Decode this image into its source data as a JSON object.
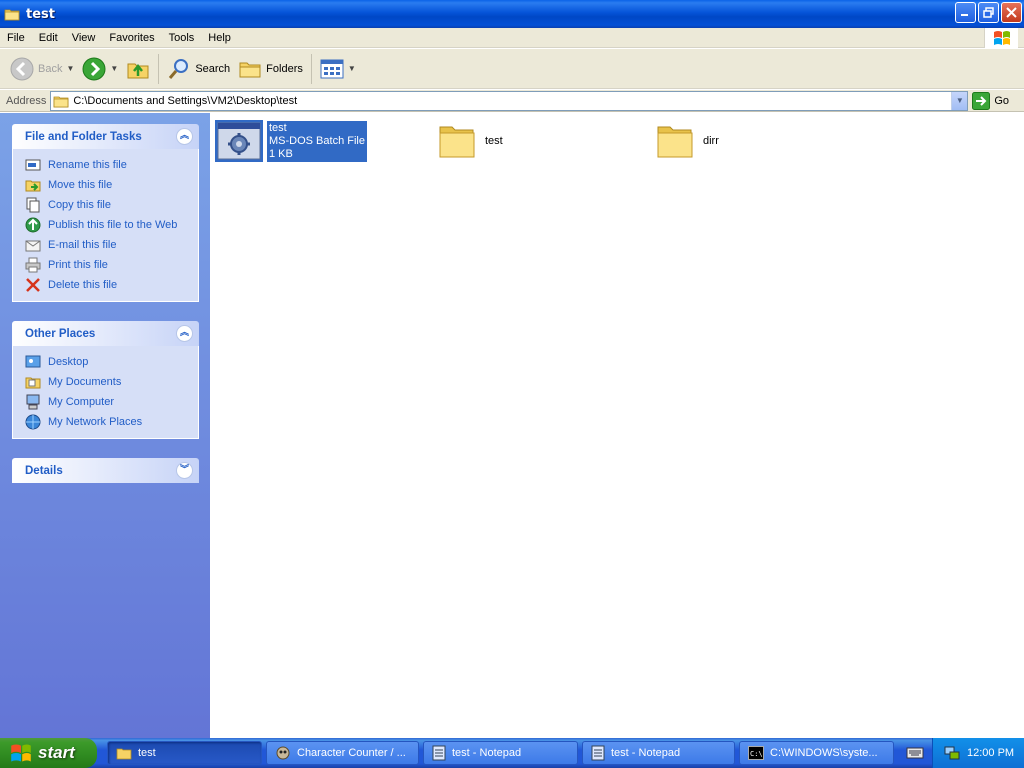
{
  "window": {
    "title": "test"
  },
  "menu": [
    "File",
    "Edit",
    "View",
    "Favorites",
    "Tools",
    "Help"
  ],
  "toolbar": {
    "back": "Back",
    "search": "Search",
    "folders": "Folders"
  },
  "address": {
    "label": "Address",
    "path": "C:\\Documents and Settings\\VM2\\Desktop\\test",
    "go": "Go"
  },
  "tasks_panel": {
    "title": "File and Folder Tasks",
    "items": [
      "Rename this file",
      "Move this file",
      "Copy this file",
      "Publish this file to the Web",
      "E-mail this file",
      "Print this file",
      "Delete this file"
    ]
  },
  "places_panel": {
    "title": "Other Places",
    "items": [
      "Desktop",
      "My Documents",
      "My Computer",
      "My Network Places"
    ]
  },
  "details_panel": {
    "title": "Details"
  },
  "files": [
    {
      "name": "test",
      "type": "MS-DOS Batch File",
      "size": "1 KB",
      "icon": "batch-file-icon"
    },
    {
      "name": "test",
      "icon": "folder-icon"
    },
    {
      "name": "dirr",
      "icon": "folder-icon"
    }
  ],
  "taskbar": {
    "start": "start",
    "tasks": [
      {
        "label": "test",
        "icon": "folder-icon"
      },
      {
        "label": "Character Counter / ...",
        "icon": "app-icon"
      },
      {
        "label": "test - Notepad",
        "icon": "notepad-icon"
      },
      {
        "label": "test - Notepad",
        "icon": "notepad-icon"
      },
      {
        "label": "C:\\WINDOWS\\syste...",
        "icon": "cmd-icon"
      }
    ],
    "clock": "12:00 PM"
  }
}
